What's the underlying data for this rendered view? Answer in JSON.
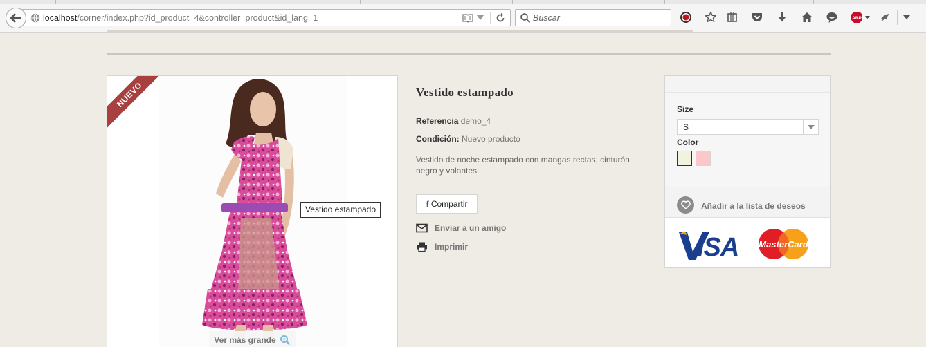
{
  "browser": {
    "url_host": "localhost",
    "url_path": "/corner/index.php?id_product=4&controller=product&id_lang=1",
    "search_placeholder": "Buscar",
    "toolbar_icons": [
      "record-icon",
      "bookmark-star-icon",
      "reading-list-icon",
      "pocket-icon",
      "download-icon",
      "home-icon",
      "chat-icon",
      "adblock-icon",
      "extension-icon",
      "menu-icon"
    ]
  },
  "product": {
    "badge": "NUEVO",
    "image_tooltip": "Vestido estampado",
    "view_larger": "Ver más grande",
    "title": "Vestido estampado",
    "reference_label": "Referencia",
    "reference_value": "demo_4",
    "condition_label": "Condición:",
    "condition_value": "Nuevo producto",
    "description": "Vestido de noche estampado con mangas rectas, cinturón negro y volantes.",
    "share_label": "Compartir",
    "send_friend": "Enviar a un amigo",
    "print": "Imprimir"
  },
  "buy_box": {
    "size_label": "Size",
    "size_selected": "S",
    "color_label": "Color",
    "colors": [
      "#f1f3df",
      "#fcc7c9"
    ],
    "wishlist": "Añadir a la lista de deseos",
    "payment_logos": [
      "VISA",
      "MasterCard"
    ]
  },
  "colors": {
    "badge": "#a7403e",
    "page_bg": "#efebe5",
    "facebook": "#3b5998"
  }
}
